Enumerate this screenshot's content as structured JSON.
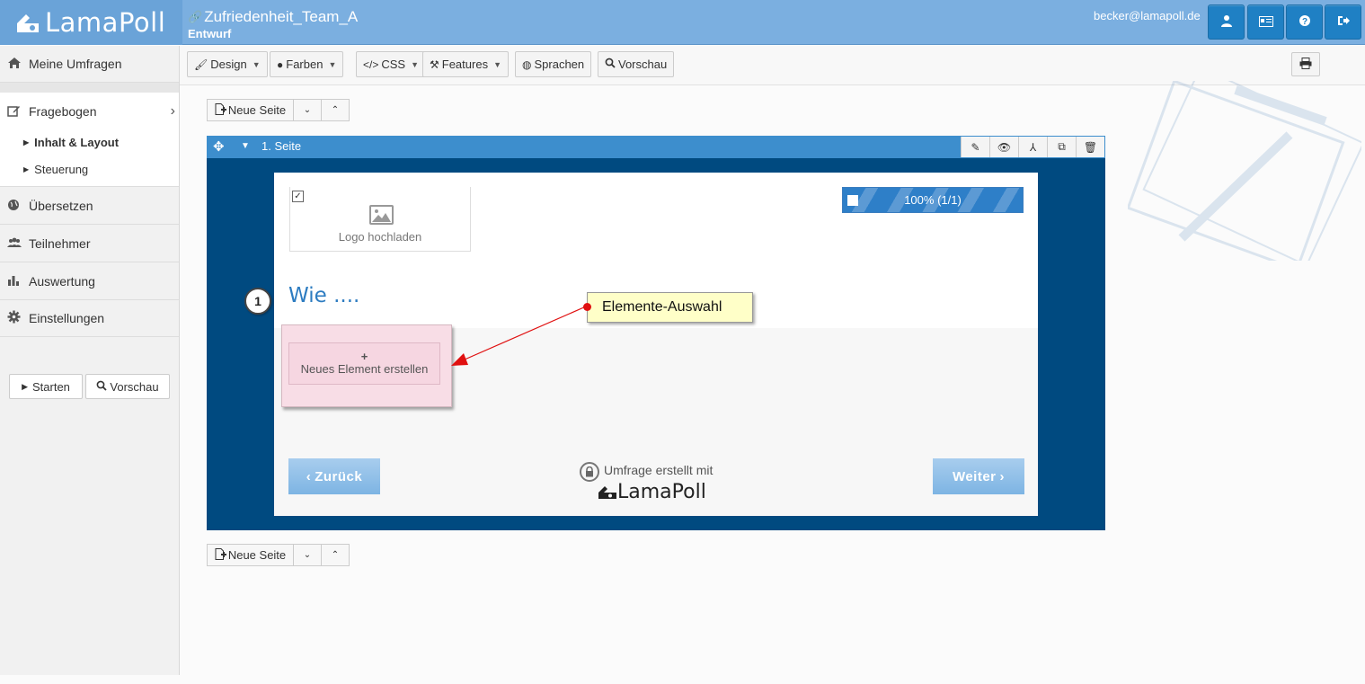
{
  "header": {
    "brand": "LamaPoll",
    "survey_title": "Zufriedenheit_Team_A",
    "survey_status": "Entwurf",
    "user_email": "becker@lamapoll.de",
    "buttons": [
      {
        "icon": "user-icon"
      },
      {
        "icon": "card-icon"
      },
      {
        "icon": "help-icon"
      },
      {
        "icon": "logout-icon"
      }
    ]
  },
  "sidebar": {
    "items": [
      {
        "label": "Meine Umfragen",
        "icon": "home-icon"
      },
      {
        "label": "Fragebogen",
        "icon": "edit-icon"
      },
      {
        "label": "Übersetzen",
        "icon": "globe-icon"
      },
      {
        "label": "Teilnehmer",
        "icon": "users-icon"
      },
      {
        "label": "Auswertung",
        "icon": "bar-chart-icon"
      },
      {
        "label": "Einstellungen",
        "icon": "gear-icon"
      }
    ],
    "sub_items": [
      {
        "label": "Inhalt & Layout",
        "active": true
      },
      {
        "label": "Steuerung",
        "active": false
      }
    ],
    "start_label": "Starten",
    "preview_label": "Vorschau"
  },
  "toolbar": {
    "design": "Design",
    "colors": "Farben",
    "css": "CSS",
    "features": "Features",
    "languages": "Sprachen",
    "preview": "Vorschau"
  },
  "page_controls": {
    "new_page": "Neue Seite"
  },
  "page": {
    "title": "1. Seite",
    "logo_upload": "Logo hochladen",
    "progress_label": "100% (1/1)",
    "progress_value": 1.0,
    "question_number": "1",
    "question_text": "Wie ....",
    "new_element": "Neues Element erstellen",
    "new_element_plus": "+",
    "back_label": "Zurück",
    "next_label": "Weiter",
    "powered_by": "Umfrage erstellt mit",
    "powered_brand": "LamaPoll"
  },
  "annotation": {
    "callout": "Elemente-Auswahl"
  },
  "colors": {
    "header": "#7bafe0",
    "page_frame": "#004a80",
    "accent": "#2d7cc1",
    "callout_bg": "#ffffc8",
    "arrow": "#e01010"
  }
}
